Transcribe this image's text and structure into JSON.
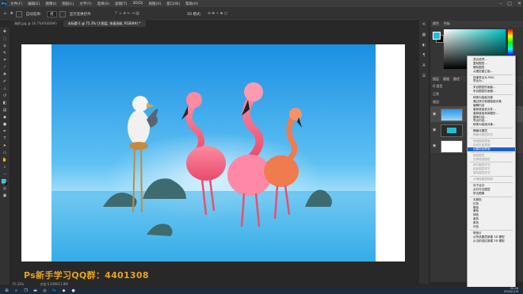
{
  "menubar": {
    "app_icon": "ps-logo",
    "items": [
      "文件(F)",
      "编辑(E)",
      "图像(I)",
      "图层(L)",
      "文字(Y)",
      "选择(S)",
      "滤镜(T)",
      "3D(D)",
      "视图(V)",
      "窗口(W)",
      "帮助(H)"
    ]
  },
  "options_bar": {
    "auto_select_label": "自动选择：",
    "auto_select_value": "组",
    "transform_label": "显示变换控件",
    "mode_label": "3D 模式："
  },
  "tabs": [
    {
      "label": "海鸥.jpg @ 16.7%(RGB/8#)"
    },
    {
      "label": "未标题-1 @ 75.3% (大图层, 快速选取, RGB/8#) *"
    }
  ],
  "toolbar": {
    "tools": [
      "move",
      "marquee",
      "lasso",
      "quick-select",
      "crop",
      "eyedropper",
      "healing",
      "brush",
      "stamp",
      "history-brush",
      "eraser",
      "gradient",
      "blur",
      "dodge",
      "pen",
      "type",
      "path-select",
      "rectangle",
      "hand",
      "zoom",
      "more",
      "fg-bg",
      "quick-mask",
      "screen-mode"
    ]
  },
  "statusbar": {
    "zoom": "75.33%",
    "doc": "文档:5.93M/11.9M"
  },
  "watermark": "Ps新手学习QQ群：4401308",
  "color_panel": {
    "tabs": [
      "颜色",
      "色板"
    ],
    "fg_color": "#1fbfd6",
    "bg_color": "#000000"
  },
  "layers_panel": {
    "tabs": [
      "图层",
      "通道",
      "路径"
    ],
    "kind_label": "Q 类型",
    "mode": "正常",
    "lock_label": "锁定:"
  },
  "context_menu": {
    "groups": [
      [
        {
          "label": "混合选项..."
        },
        {
          "label": "复制图层..."
        },
        {
          "label": "删除图层"
        },
        {
          "label": "从图层建立组..."
        }
      ],
      [
        {
          "label": "快速导出为 PNG"
        },
        {
          "label": "导出为..."
        }
      ],
      [
        {
          "label": "来自图层的画板..."
        },
        {
          "label": "来自图层的画框..."
        }
      ],
      [
        {
          "label": "转换为智能对象"
        },
        {
          "label": "通过拷贝新建智能对象"
        },
        {
          "label": "编辑内容"
        },
        {
          "label": "重新链接到文件..."
        },
        {
          "label": "重新链接到库图形..."
        },
        {
          "label": "替换内容..."
        },
        {
          "label": "导出内容..."
        },
        {
          "label": "转换为链接对象..."
        }
      ],
      [
        {
          "label": "栅格化图层"
        },
        {
          "label": "栅格化图层样式",
          "disabled": true
        }
      ],
      [
        {
          "label": "停用图层蒙版",
          "disabled": true
        },
        {
          "label": "启用矢量蒙版",
          "disabled": true
        },
        {
          "label": "创建剪贴蒙版",
          "highlighted": true
        }
      ],
      [
        {
          "label": "链接图层",
          "disabled": true
        },
        {
          "label": "选择链接图层",
          "disabled": true
        }
      ],
      [
        {
          "label": "拷贝图层样式",
          "disabled": true
        },
        {
          "label": "粘贴图层样式",
          "disabled": true
        },
        {
          "label": "清除图层样式",
          "disabled": true
        }
      ],
      [
        {
          "label": "从隔离图层释放",
          "disabled": true
        }
      ],
      [
        {
          "label": "向下合并"
        },
        {
          "label": "合并可见图层"
        },
        {
          "label": "拼合图像"
        }
      ],
      [
        {
          "label": "无颜色"
        },
        {
          "label": "红色"
        },
        {
          "label": "橙色"
        },
        {
          "label": "黄色"
        },
        {
          "label": "绿色"
        },
        {
          "label": "蓝色"
        },
        {
          "label": "紫色"
        },
        {
          "label": "灰色"
        }
      ],
      [
        {
          "label": "明信片"
        },
        {
          "label": "从所选图层新建 3D 模型"
        },
        {
          "label": "从当前选区新建 3D 模型"
        }
      ]
    ]
  },
  "taskbar": {
    "icons": [
      "windows-icon",
      "search-icon",
      "taskview-icon",
      "explorer-icon",
      "browser-icon",
      "photoshop-icon",
      "app-icon",
      "app-icon"
    ],
    "time": "20:26",
    "date": "2020/11/9"
  }
}
